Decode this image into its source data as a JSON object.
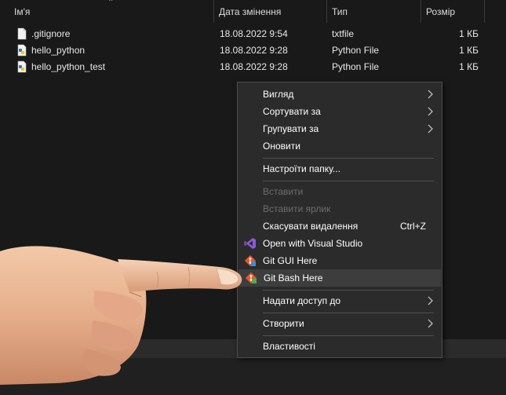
{
  "columns": {
    "name": "Ім'я",
    "date": "Дата змінення",
    "type": "Тип",
    "size": "Розмір"
  },
  "files": [
    {
      "name": ".gitignore",
      "date": "18.08.2022 9:54",
      "type": "txtfile",
      "size": "1 КБ",
      "icon": "text-file-icon"
    },
    {
      "name": "hello_python",
      "date": "18.08.2022 9:28",
      "type": "Python File",
      "size": "1 КБ",
      "icon": "python-file-icon"
    },
    {
      "name": "hello_python_test",
      "date": "18.08.2022 9:28",
      "type": "Python File",
      "size": "1 КБ",
      "icon": "python-file-icon"
    }
  ],
  "context_menu": {
    "view": "Вигляд",
    "sort_by": "Сортувати за",
    "group_by": "Групувати за",
    "refresh": "Оновити",
    "customize_folder": "Настроїти папку...",
    "paste": "Вставити",
    "paste_shortcut": "Вставити ярлик",
    "undo_delete": "Скасувати видалення",
    "undo_delete_shortcut": "Ctrl+Z",
    "open_visual_studio": "Open with Visual Studio",
    "git_gui": "Git GUI Here",
    "git_bash": "Git Bash Here",
    "give_access": "Надати доступ до",
    "new": "Створити",
    "properties": "Властивості"
  },
  "colors": {
    "background": "#191919",
    "menu_background": "#2b2b2b",
    "menu_hover": "#3d3d3d",
    "disabled_text": "#6d6d6d",
    "visual_studio_purple": "#8a5cd6",
    "git_orange": "#e8562a"
  }
}
